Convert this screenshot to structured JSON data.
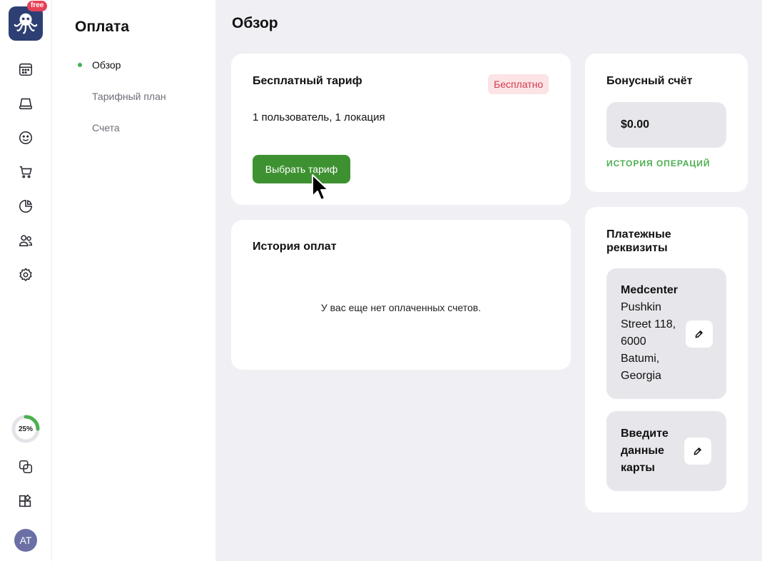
{
  "app": {
    "badge": "free"
  },
  "rail": {
    "items": [
      {
        "name": "calendar-icon"
      },
      {
        "name": "cash-register-icon"
      },
      {
        "name": "smiley-icon"
      },
      {
        "name": "cart-icon"
      },
      {
        "name": "pie-chart-icon"
      },
      {
        "name": "users-icon"
      },
      {
        "name": "gear-icon"
      }
    ],
    "progress": {
      "label": "25%",
      "value": 0.25,
      "color": "#4caf50"
    },
    "bottom": [
      {
        "name": "copy-icon"
      },
      {
        "name": "add-widget-icon"
      }
    ],
    "avatar": "AT"
  },
  "subnav": {
    "title": "Оплата",
    "items": [
      {
        "label": "Обзор",
        "active": true
      },
      {
        "label": "Тарифный план",
        "active": false
      },
      {
        "label": "Счета",
        "active": false
      }
    ]
  },
  "main": {
    "title": "Обзор",
    "plan_card": {
      "title": "Бесплатный тариф",
      "badge": "Бесплатно",
      "description": "1 пользователь, 1 локация",
      "button": "Выбрать тариф"
    },
    "history_card": {
      "title": "История оплат",
      "empty": "У вас еще нет оплаченных счетов."
    },
    "bonus_card": {
      "title": "Бонусный счёт",
      "balance": "$0.00",
      "link": "ИСТОРИЯ ОПЕРАЦИЙ"
    },
    "requisites_card": {
      "title_line1": "Платежные",
      "title_line2": "реквизиты",
      "address": {
        "name": "Medcenter",
        "lines": [
          "Pushkin",
          "Street 118,",
          "6000",
          "Batumi,",
          "Georgia"
        ]
      },
      "card_prompt": [
        "Введите",
        "данные",
        "карты"
      ]
    }
  },
  "colors": {
    "accent": "#3e9131",
    "logo_bg": "#2d3f73",
    "badge_red": "#e64257"
  }
}
